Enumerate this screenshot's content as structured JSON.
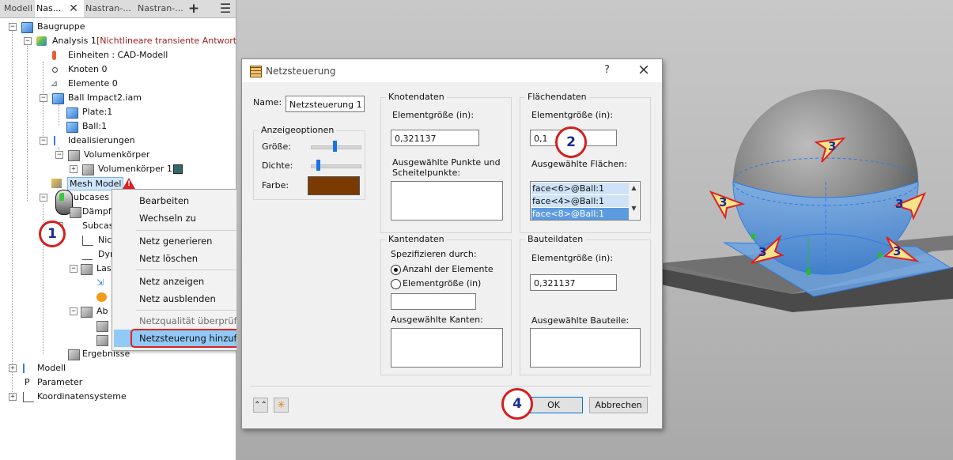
{
  "browser": {
    "tabs": [
      "Modell",
      "Nas...",
      "Nastran-...",
      "Nastran-..."
    ],
    "tree": {
      "root": "Baugruppe",
      "analysis": "Analysis 1",
      "analysis_type": "[Nichtlineare transiente Antworts",
      "units": "Einheiten : CAD-Modell",
      "nodes": "Knoten 0",
      "elements": "Elemente 0",
      "assembly": "Ball Impact2.iam",
      "part1": "Plate:1",
      "part2": "Ball:1",
      "idealizations": "Idealisierungen",
      "solid": "Volumenkörper",
      "solid1": "Volumenkörper 1",
      "mesh_model": "Mesh Model",
      "subcases": "Subcases",
      "damping": "Dämpf",
      "subcase": "Subcas",
      "nic": "Nic",
      "dyn": "Dyn",
      "las": "Las",
      "ab": "Ab",
      "results": "Ergebnisse",
      "model": "Modell",
      "parameters": "Parameter",
      "coords": "Koordinatensysteme"
    }
  },
  "context_menu": {
    "items": [
      "Bearbeiten",
      "Wechseln zu",
      "Netz generieren",
      "Netz löschen",
      "Netz anzeigen",
      "Netz ausblenden",
      "Netzqualität überprüfen",
      "Netzsteuerung hinzufügen"
    ],
    "submenu_arrow": "›"
  },
  "dialog": {
    "title": "Netzsteuerung",
    "help": "?",
    "close": "×",
    "name_label": "Name:",
    "name_value": "Netzsteuerung 1",
    "display_options": "Anzeigeoptionen",
    "size_label": "Größe:",
    "density_label": "Dichte:",
    "color_label": "Farbe:",
    "color_value": "#7b3a00",
    "node_data": {
      "title": "Knotendaten",
      "elem_size_label": "Elementgröße (in):",
      "elem_size_value": "0,321137",
      "points_label": "Ausgewählte Punkte und Scheitelpunkte:"
    },
    "face_data": {
      "title": "Flächendaten",
      "elem_size_label": "Elementgröße (in):",
      "elem_size_value": "0,1",
      "faces_label": "Ausgewählte Flächen:",
      "faces": [
        "face<6>@Ball:1",
        "face<4>@Ball:1",
        "face<8>@Ball:1"
      ]
    },
    "edge_data": {
      "title": "Kantendaten",
      "spec_label": "Spezifizieren durch:",
      "opt_count": "Anzahl der Elemente",
      "opt_size": "Elementgröße (in)",
      "edges_label": "Ausgewählte Kanten:"
    },
    "part_data": {
      "title": "Bauteildaten",
      "elem_size_label": "Elementgröße (in):",
      "elem_size_value": "0,321137",
      "parts_label": "Ausgewählte Bauteile:"
    },
    "ok": "OK",
    "cancel": "Abbrechen"
  },
  "callouts": [
    "1",
    "2",
    "3",
    "4"
  ]
}
